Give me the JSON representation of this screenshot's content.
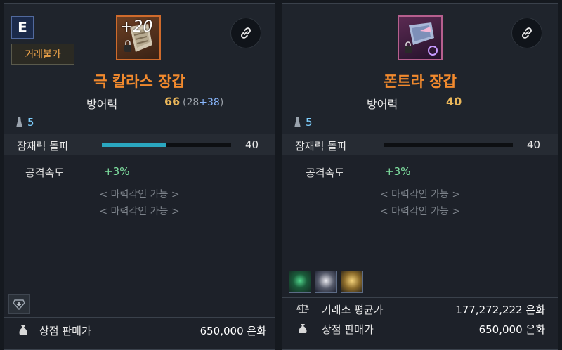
{
  "left": {
    "grade": "E",
    "tradability": "거래불가",
    "upgrade": "+20",
    "item_name": "극 칼라스 장갑",
    "stat_label": "방어력",
    "stat_value": "66",
    "stat_base": "(28",
    "stat_bonus": "+38",
    "stat_close": ")",
    "tier": "5",
    "breakthrough_label": "잠재력 돌파",
    "breakthrough_value": "40",
    "breakthrough_fill_pct": 50,
    "effect_label": "공격속도",
    "effect_value": "+3%",
    "engrave_1": "< 마력각인 가능 >",
    "engrave_2": "< 마력각인 가능 >",
    "shop_price_label": "상점 판매가",
    "shop_price_value": "650,000 은화"
  },
  "right": {
    "item_name": "폰트라 장갑",
    "stat_label": "방어력",
    "stat_value": "40",
    "tier": "5",
    "breakthrough_label": "잠재력 돌파",
    "breakthrough_value": "40",
    "breakthrough_fill_pct": 0,
    "effect_label": "공격속도",
    "effect_value": "+3%",
    "engrave_1": "< 마력각인 가능 >",
    "engrave_2": "< 마력각인 가능 >",
    "market_avg_label": "거래소 평균가",
    "market_avg_value": "177,272,222 은화",
    "shop_price_label": "상점 판매가",
    "shop_price_value": "650,000 은화"
  },
  "colors": {
    "item_name": "#f28a2e",
    "stat_value": "#e9b65a",
    "effect_value": "#7fe0a0",
    "bar_fill": "#2aa7c0",
    "tier": "#7fd0ff"
  },
  "icons": {
    "link": "link-icon",
    "lock": "lock-icon",
    "pawn": "pawn-icon",
    "silver_bag": "silver-bag-icon",
    "scale": "scale-icon",
    "gem_add": "gem-add-icon"
  }
}
